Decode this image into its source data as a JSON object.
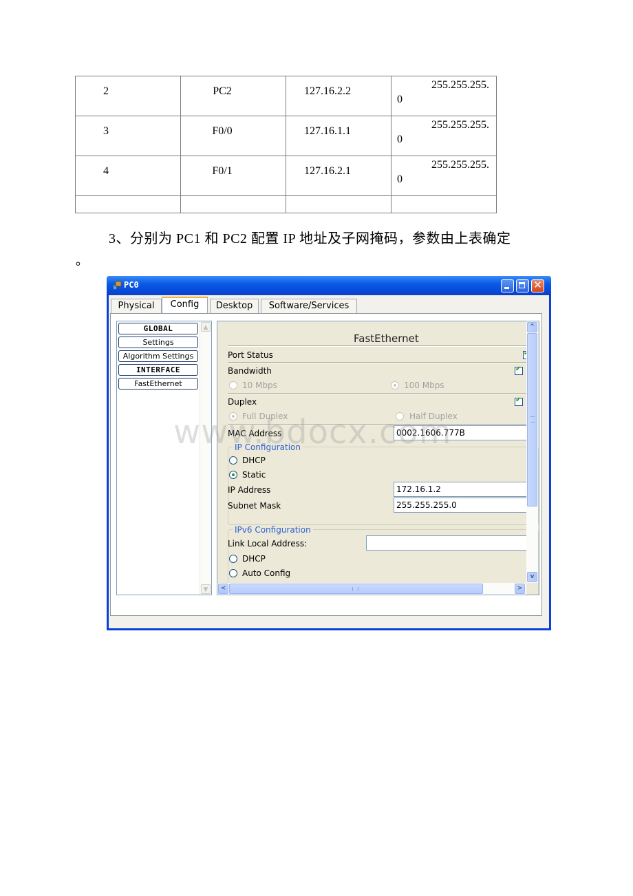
{
  "table": {
    "rows": [
      {
        "no": "2",
        "device": "PC2",
        "ip": "127.16.2.2",
        "mask_line1": "255.255.255.",
        "mask_line2": "0"
      },
      {
        "no": "3",
        "device": "F0/0",
        "ip": "127.16.1.1",
        "mask_line1": "255.255.255.",
        "mask_line2": "0"
      },
      {
        "no": "4",
        "device": "F0/1",
        "ip": "127.16.2.1",
        "mask_line1": "255.255.255.",
        "mask_line2": "0"
      }
    ]
  },
  "paragraph": {
    "text": "3、分别为 PC1 和 PC2 配置 IP 地址及子网掩码，参数由上表确定",
    "trailing": "。"
  },
  "window": {
    "title": "PC0",
    "icons": {
      "app": "pc-device-icon",
      "minimize": "minimize-icon",
      "maximize": "maximize-icon",
      "close": "close-icon"
    },
    "close_glyph": "✕",
    "tabs": [
      {
        "label": "Physical",
        "active": false
      },
      {
        "label": "Config",
        "active": true
      },
      {
        "label": "Desktop",
        "active": false
      },
      {
        "label": "Software/Services",
        "active": false
      }
    ],
    "sidebar": {
      "items": [
        {
          "label": "GLOBAL",
          "type": "header"
        },
        {
          "label": "Settings",
          "type": "item"
        },
        {
          "label": "Algorithm Settings",
          "type": "item"
        },
        {
          "label": "INTERFACE",
          "type": "header"
        },
        {
          "label": "FastEthernet",
          "type": "item"
        }
      ]
    },
    "panel": {
      "heading": "FastEthernet",
      "port_status": {
        "label": "Port Status",
        "checked": true
      },
      "bandwidth": {
        "label": "Bandwidth",
        "auto_checked": true,
        "options": [
          "10 Mbps",
          "100 Mbps"
        ],
        "selected": "100 Mbps"
      },
      "duplex": {
        "label": "Duplex",
        "auto_checked": true,
        "options": [
          "Full Duplex",
          "Half Duplex"
        ],
        "selected": "Full Duplex"
      },
      "mac": {
        "label": "MAC Address",
        "value": "0002.1606.777B"
      },
      "ip_config": {
        "legend": "IP Configuration",
        "dhcp_label": "DHCP",
        "static_label": "Static",
        "mode": "Static",
        "ip_label": "IP Address",
        "ip_value": "172.16.1.2",
        "mask_label": "Subnet Mask",
        "mask_value": "255.255.255.0"
      },
      "ipv6_config": {
        "legend": "IPv6 Configuration",
        "link_local_label": "Link Local Address:",
        "link_local_value": "",
        "dhcp_label": "DHCP",
        "auto_label": "Auto Config"
      }
    }
  },
  "watermark": "www.bdocx.com"
}
